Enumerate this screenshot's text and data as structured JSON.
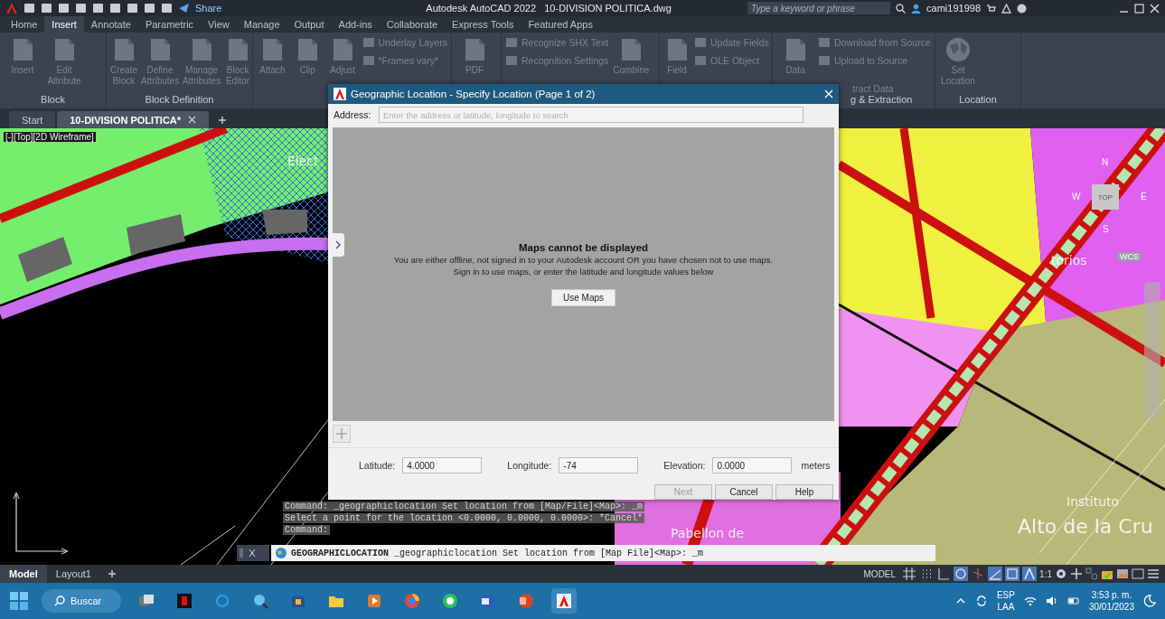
{
  "title_bar": {
    "share": "Share",
    "title": "Autodesk AutoCAD 2022",
    "file": "10-DIVISION POLITICA.dwg",
    "search": {
      "placeholder": "Type a keyword or phrase"
    },
    "user": "cami191998"
  },
  "ribbon_tabs": [
    {
      "label": "Home",
      "selected": false
    },
    {
      "label": "Insert",
      "selected": true
    },
    {
      "label": "Annotate",
      "selected": false
    },
    {
      "label": "Parametric",
      "selected": false
    },
    {
      "label": "View",
      "selected": false
    },
    {
      "label": "Manage",
      "selected": false
    },
    {
      "label": "Output",
      "selected": false
    },
    {
      "label": "Add-ins",
      "selected": false
    },
    {
      "label": "Collaborate",
      "selected": false
    },
    {
      "label": "Express Tools",
      "selected": false
    },
    {
      "label": "Featured Apps",
      "selected": false
    }
  ],
  "ribbon_panels": [
    {
      "label": "Block",
      "tools": [
        {
          "label": "Insert",
          "kind": "large"
        },
        {
          "label": "Edit Attribute",
          "kind": "large"
        }
      ]
    },
    {
      "label": "Block Definition",
      "tools": [
        {
          "label": "Create Block",
          "kind": "large"
        },
        {
          "label": "Define Attributes",
          "kind": "large"
        },
        {
          "label": "Manage Attributes",
          "kind": "large"
        },
        {
          "label": "Block Editor",
          "kind": "large"
        }
      ]
    },
    {
      "tools": [
        {
          "label": "Attach",
          "kind": "large"
        },
        {
          "label": "Clip",
          "kind": "large"
        },
        {
          "label": "Adjust",
          "kind": "large"
        },
        {
          "label": "Underlay Layers",
          "kind": "small"
        },
        {
          "label": "*Frames vary*",
          "kind": "small"
        }
      ]
    },
    {
      "tools": [
        {
          "label": "PDF",
          "kind": "large"
        }
      ]
    },
    {
      "tools": [
        {
          "label": "Recognize SHX Text",
          "kind": "small"
        },
        {
          "label": "Recognition Settings",
          "kind": "small"
        },
        {
          "label": "Combine",
          "kind": "large"
        }
      ]
    },
    {
      "tools": [
        {
          "label": "Field",
          "kind": "large"
        },
        {
          "label": "Update Fields",
          "kind": "small"
        },
        {
          "label": "OLE Object",
          "kind": "small"
        }
      ]
    },
    {
      "label": "g & Extraction",
      "clipped_tool": "tract  Data",
      "tools": [
        {
          "label": "Data",
          "kind": "large"
        },
        {
          "label": "Download from Source",
          "kind": "small"
        },
        {
          "label": "Upload to Source",
          "kind": "small"
        }
      ]
    },
    {
      "label": "Location",
      "tools": [
        {
          "label": "Set Location",
          "kind": "large"
        }
      ]
    }
  ],
  "doc_tabs": [
    {
      "label": "Start",
      "selected": false
    },
    {
      "label": "10-DIVISION POLITICA*",
      "selected": true
    }
  ],
  "viewport": {
    "label": "[-][Top][2D Wireframe]",
    "map_labels": [
      "Elect",
      "torios",
      "Pabellon de",
      "Instituto",
      "Alto de la Cru"
    ],
    "wcs": "WCS",
    "viewcube": {
      "north": "N",
      "west": "W",
      "face": "TOP",
      "east": "E",
      "south": "S"
    }
  },
  "command_history": [
    "Command: _geographiclocation Set location from [Map/File]<Map>: _m",
    "Select a point for the location <0.0000, 0.0000, 0.0000>: *Cancel*",
    "Command:"
  ],
  "command_line": {
    "command": "GEOGRAPHICLOCATION",
    "text": "_geographiclocation Set location from [Map File]<Map>: _m"
  },
  "dialog": {
    "title": "Geographic Location - Specify Location (Page 1 of 2)",
    "address": {
      "label": "Address:",
      "placeholder": "Enter the address or latitude, longitude to search"
    },
    "map_heading": "Maps cannot be displayed",
    "map_message": [
      "You are either offline, not signed in to your Autodesk account OR you have chosen not to use maps.",
      "Sign in to use maps, or enter the latitude and longitude values below"
    ],
    "use_maps": "Use Maps",
    "fields": [
      {
        "label": "Latitude:",
        "value": "4.0000"
      },
      {
        "label": "Longitude:",
        "value": "-74"
      },
      {
        "label": "Elevation:",
        "value": "0.0000",
        "unit": "meters"
      }
    ],
    "buttons": [
      {
        "label": "Next",
        "disabled": true
      },
      {
        "label": "Cancel",
        "disabled": false
      },
      {
        "label": "Help",
        "disabled": false
      }
    ]
  },
  "layout_tabs": [
    {
      "label": "Model",
      "selected": true
    },
    {
      "label": "Layout1",
      "selected": false
    }
  ],
  "status_bar": {
    "mode": "MODEL",
    "scale": "1:1",
    "toggles": [
      {
        "on": false
      },
      {
        "on": false
      },
      {
        "on": false
      },
      {
        "on": true
      },
      {
        "on": false
      },
      {
        "on": true
      },
      {
        "on": true
      },
      {
        "on": true
      }
    ]
  },
  "taskbar": {
    "search": "Buscar",
    "apps": [
      {
        "selected": false
      },
      {
        "selected": false
      },
      {
        "selected": false
      },
      {
        "selected": false
      },
      {
        "selected": false
      },
      {
        "selected": false
      },
      {
        "selected": false
      },
      {
        "selected": false
      },
      {
        "selected": false
      },
      {
        "selected": false
      },
      {
        "selected": false
      },
      {
        "selected": true
      }
    ],
    "language": "ESP",
    "region": "LAA",
    "time": "3:53 p. m.",
    "date": "30/01/2023"
  }
}
